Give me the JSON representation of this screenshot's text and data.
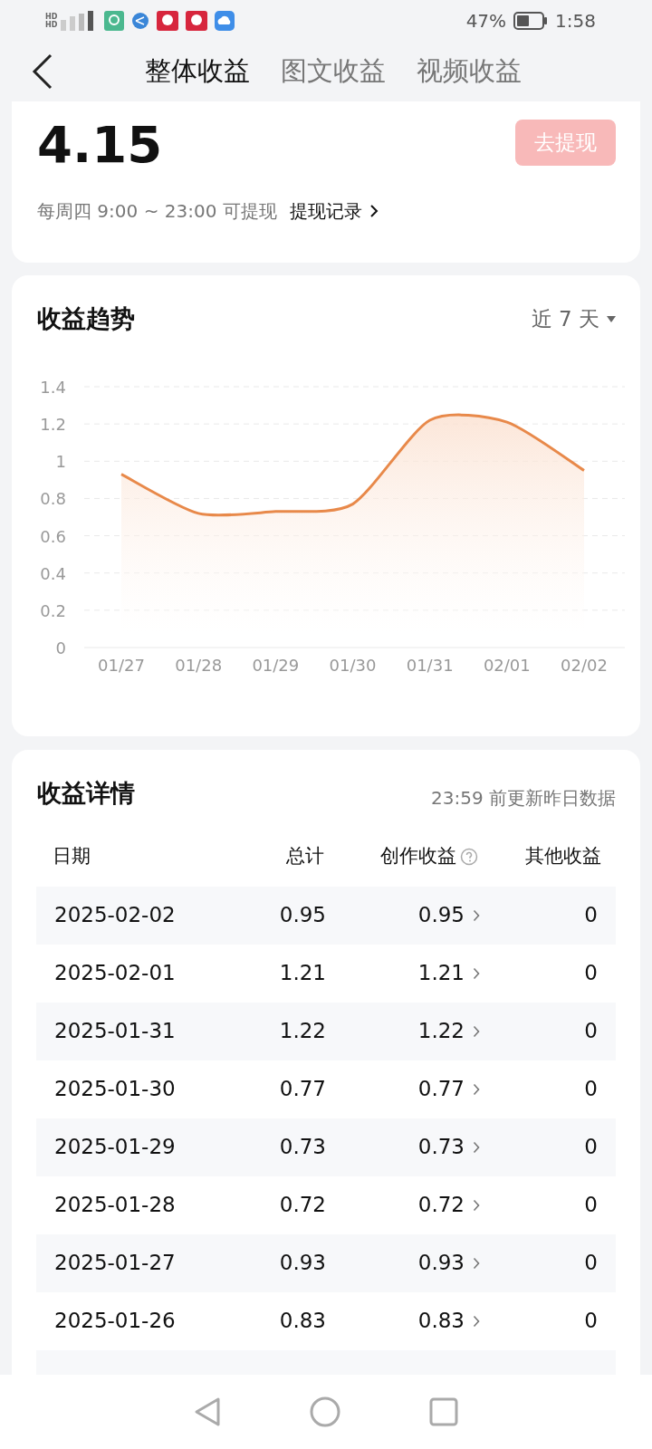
{
  "status_bar": {
    "network_labels": [
      "HD",
      "HD"
    ],
    "battery": "47%",
    "time": "1:58"
  },
  "header": {
    "tabs": [
      {
        "label": "整体收益",
        "selected": true
      },
      {
        "label": "图文收益",
        "selected": false
      },
      {
        "label": "视频收益",
        "selected": false
      }
    ]
  },
  "balance": {
    "amount": "4.15",
    "withdraw_button": "去提现",
    "schedule": "每周四 9:00 ~ 23:00 可提现",
    "records_link": "提现记录"
  },
  "trend": {
    "title": "收益趋势",
    "range": "近 7 天",
    "chart_data": {
      "type": "area",
      "categories": [
        "01/27",
        "01/28",
        "01/29",
        "01/30",
        "01/31",
        "02/01",
        "02/02"
      ],
      "grid": true,
      "series": [
        {
          "color": "#e8894a",
          "values": [
            0.93,
            0.72,
            0.73,
            0.77,
            1.22,
            1.21,
            0.95
          ]
        }
      ],
      "ylim": [
        0,
        1.4
      ],
      "yticks": [
        0,
        0.2,
        0.4,
        0.6,
        0.8,
        1,
        1.2,
        1.4
      ]
    }
  },
  "details": {
    "title": "收益详情",
    "note": "23:59 前更新昨日数据",
    "columns": [
      "日期",
      "总计",
      "创作收益",
      "其他收益"
    ],
    "rows": [
      {
        "date": "2025-02-02",
        "total": "0.95",
        "creation": "0.95",
        "other": "0"
      },
      {
        "date": "2025-02-01",
        "total": "1.21",
        "creation": "1.21",
        "other": "0"
      },
      {
        "date": "2025-01-31",
        "total": "1.22",
        "creation": "1.22",
        "other": "0"
      },
      {
        "date": "2025-01-30",
        "total": "0.77",
        "creation": "0.77",
        "other": "0"
      },
      {
        "date": "2025-01-29",
        "total": "0.73",
        "creation": "0.73",
        "other": "0"
      },
      {
        "date": "2025-01-28",
        "total": "0.72",
        "creation": "0.72",
        "other": "0"
      },
      {
        "date": "2025-01-27",
        "total": "0.93",
        "creation": "0.93",
        "other": "0"
      },
      {
        "date": "2025-01-26",
        "total": "0.83",
        "creation": "0.83",
        "other": "0"
      }
    ]
  }
}
